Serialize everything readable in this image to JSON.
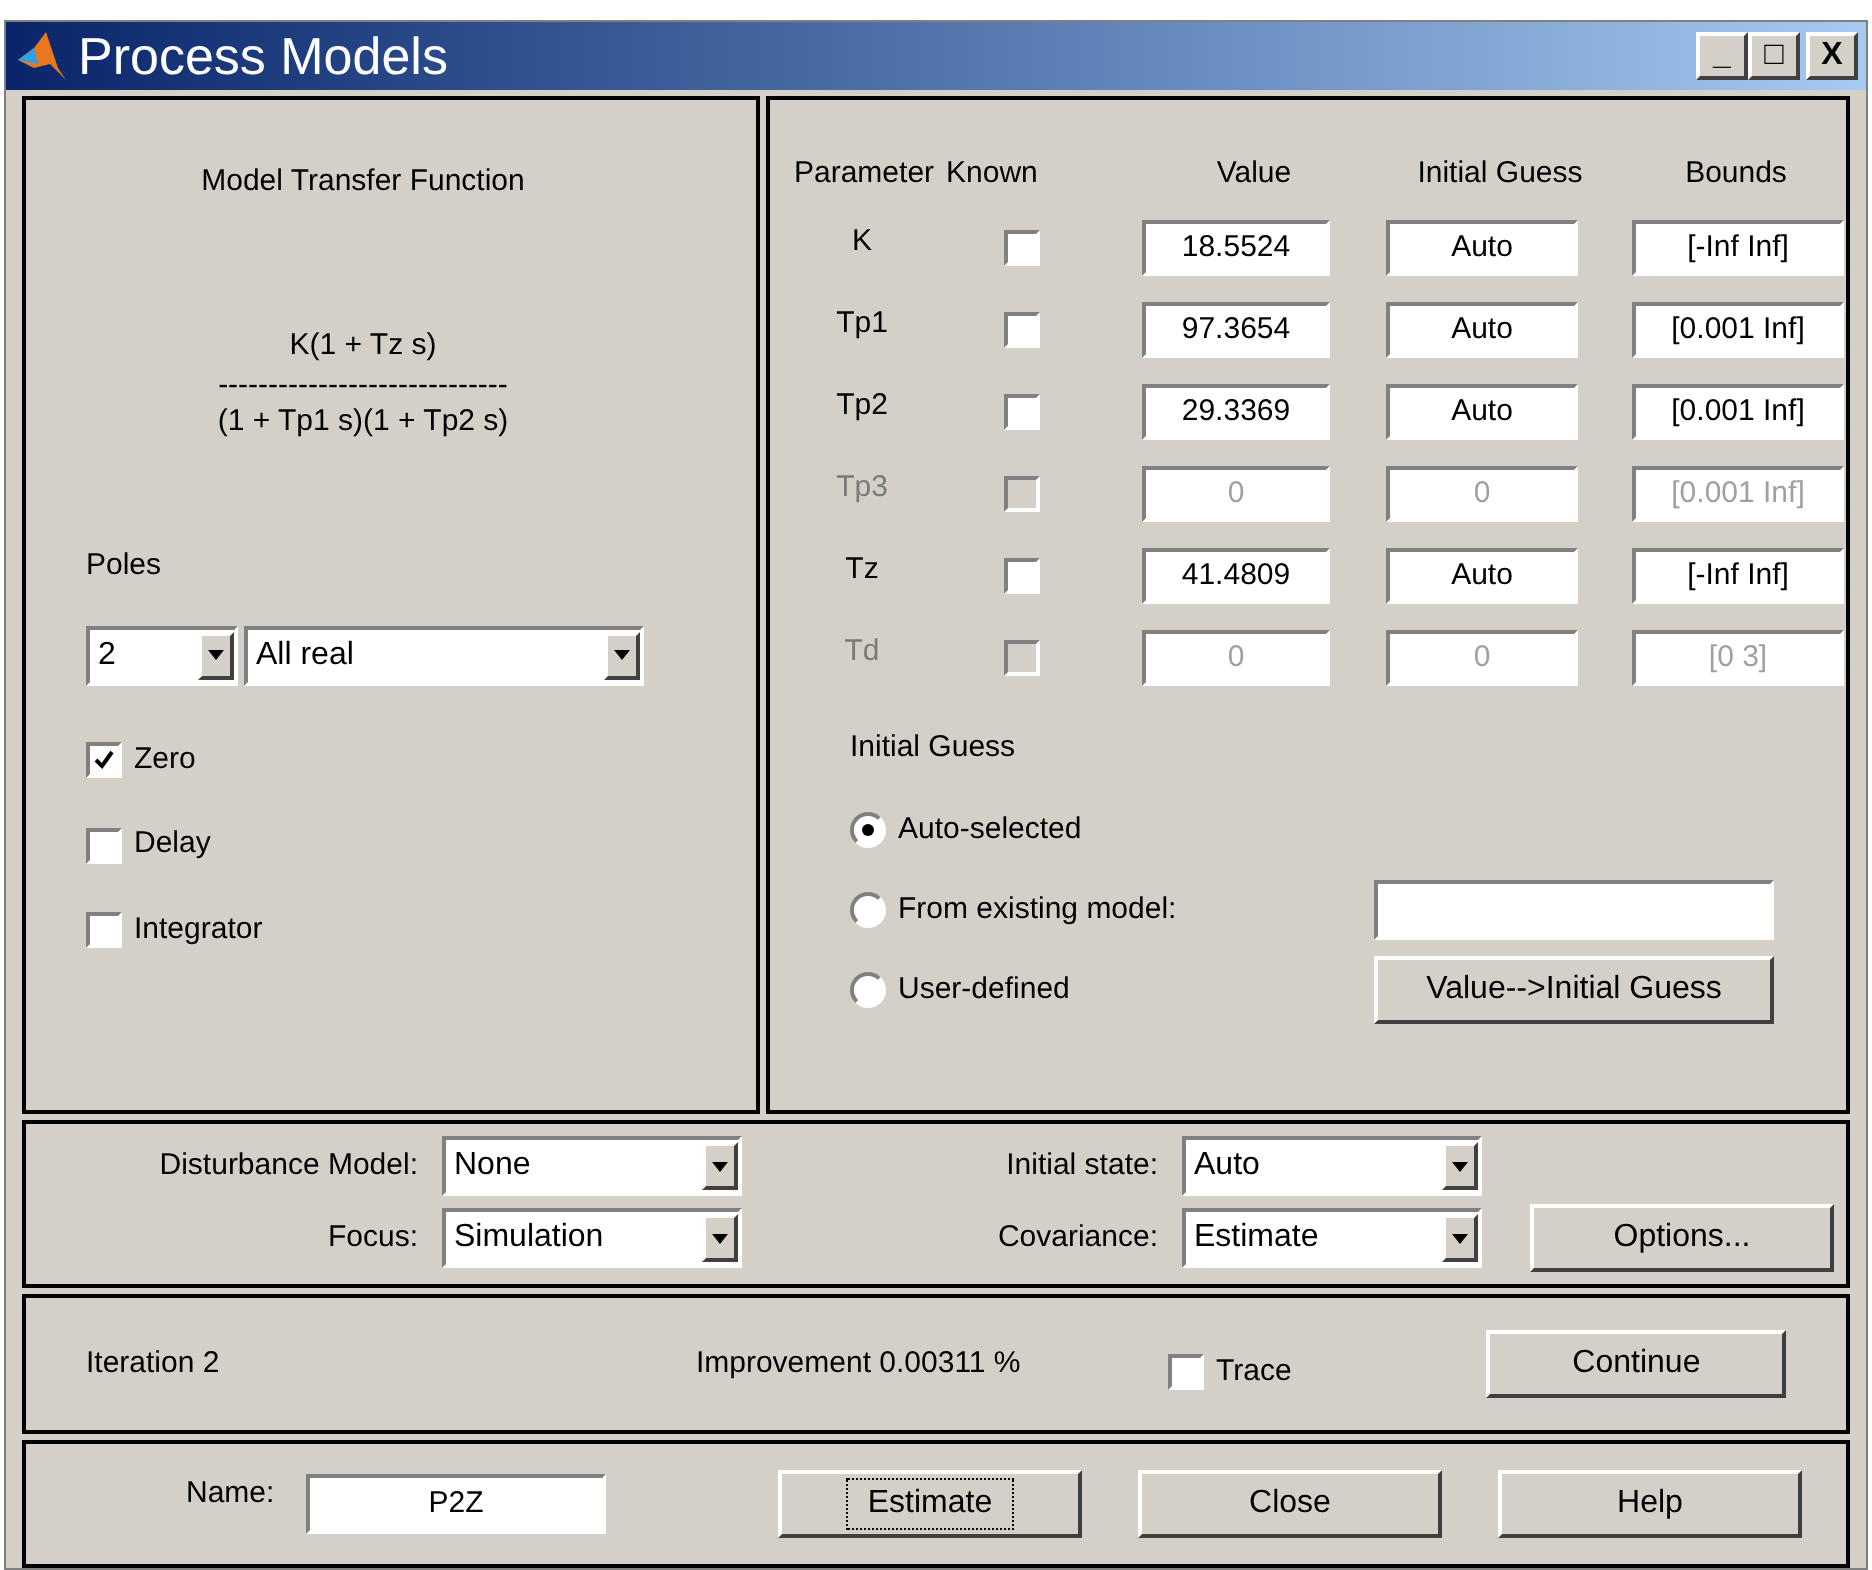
{
  "window": {
    "title": "Process Models",
    "controls": [
      "_",
      "□",
      "X"
    ]
  },
  "model_panel": {
    "title": "Model Transfer Function",
    "numerator": "K(1 + Tz s)",
    "fraction_bar": "-----------------------------",
    "denominator": "(1 + Tp1 s)(1 + Tp2 s)",
    "poles_label": "Poles",
    "poles_count": "2",
    "poles_type": "All real",
    "options": [
      {
        "label": "Zero",
        "checked": true
      },
      {
        "label": "Delay",
        "checked": false
      },
      {
        "label": "Integrator",
        "checked": false
      }
    ]
  },
  "parameters": {
    "columns": [
      "Parameter",
      "Known",
      "Value",
      "Initial Guess",
      "Bounds"
    ],
    "rows": [
      {
        "name": "K",
        "known": false,
        "disabled": false,
        "value": "18.5524",
        "initial_guess": "Auto",
        "bounds": "[-Inf Inf]"
      },
      {
        "name": "Tp1",
        "known": false,
        "disabled": false,
        "value": "97.3654",
        "initial_guess": "Auto",
        "bounds": "[0.001 Inf]"
      },
      {
        "name": "Tp2",
        "known": false,
        "disabled": false,
        "value": "29.3369",
        "initial_guess": "Auto",
        "bounds": "[0.001 Inf]"
      },
      {
        "name": "Tp3",
        "known": false,
        "disabled": true,
        "value": "0",
        "initial_guess": "0",
        "bounds": "[0.001 Inf]"
      },
      {
        "name": "Tz",
        "known": false,
        "disabled": false,
        "value": "41.4809",
        "initial_guess": "Auto",
        "bounds": "[-Inf Inf]"
      },
      {
        "name": "Td",
        "known": false,
        "disabled": true,
        "value": "0",
        "initial_guess": "0",
        "bounds": "[0 3]"
      }
    ]
  },
  "initial_guess": {
    "title": "Initial Guess",
    "choices": [
      {
        "label": "Auto-selected",
        "selected": true
      },
      {
        "label": "From existing model:",
        "selected": false
      },
      {
        "label": "User-defined",
        "selected": false
      }
    ],
    "copy_button": "Value-->Initial Guess"
  },
  "estimation": {
    "disturbance_label": "Disturbance Model:",
    "disturbance": "None",
    "focus_label": "Focus:",
    "focus": "Simulation",
    "initial_state_label": "Initial state:",
    "initial_state": "Auto",
    "covariance_label": "Covariance:",
    "covariance": "Estimate",
    "options_button": "Options..."
  },
  "progress": {
    "iteration": "Iteration 2",
    "improvement": "Improvement 0.00311 %",
    "trace": {
      "label": "Trace",
      "checked": false
    },
    "continue_button": "Continue"
  },
  "footer": {
    "name_label": "Name:",
    "name": "P2Z",
    "buttons": [
      {
        "label": "Estimate",
        "focused": true
      },
      {
        "label": "Close",
        "focused": false
      },
      {
        "label": "Help",
        "focused": false
      }
    ]
  }
}
